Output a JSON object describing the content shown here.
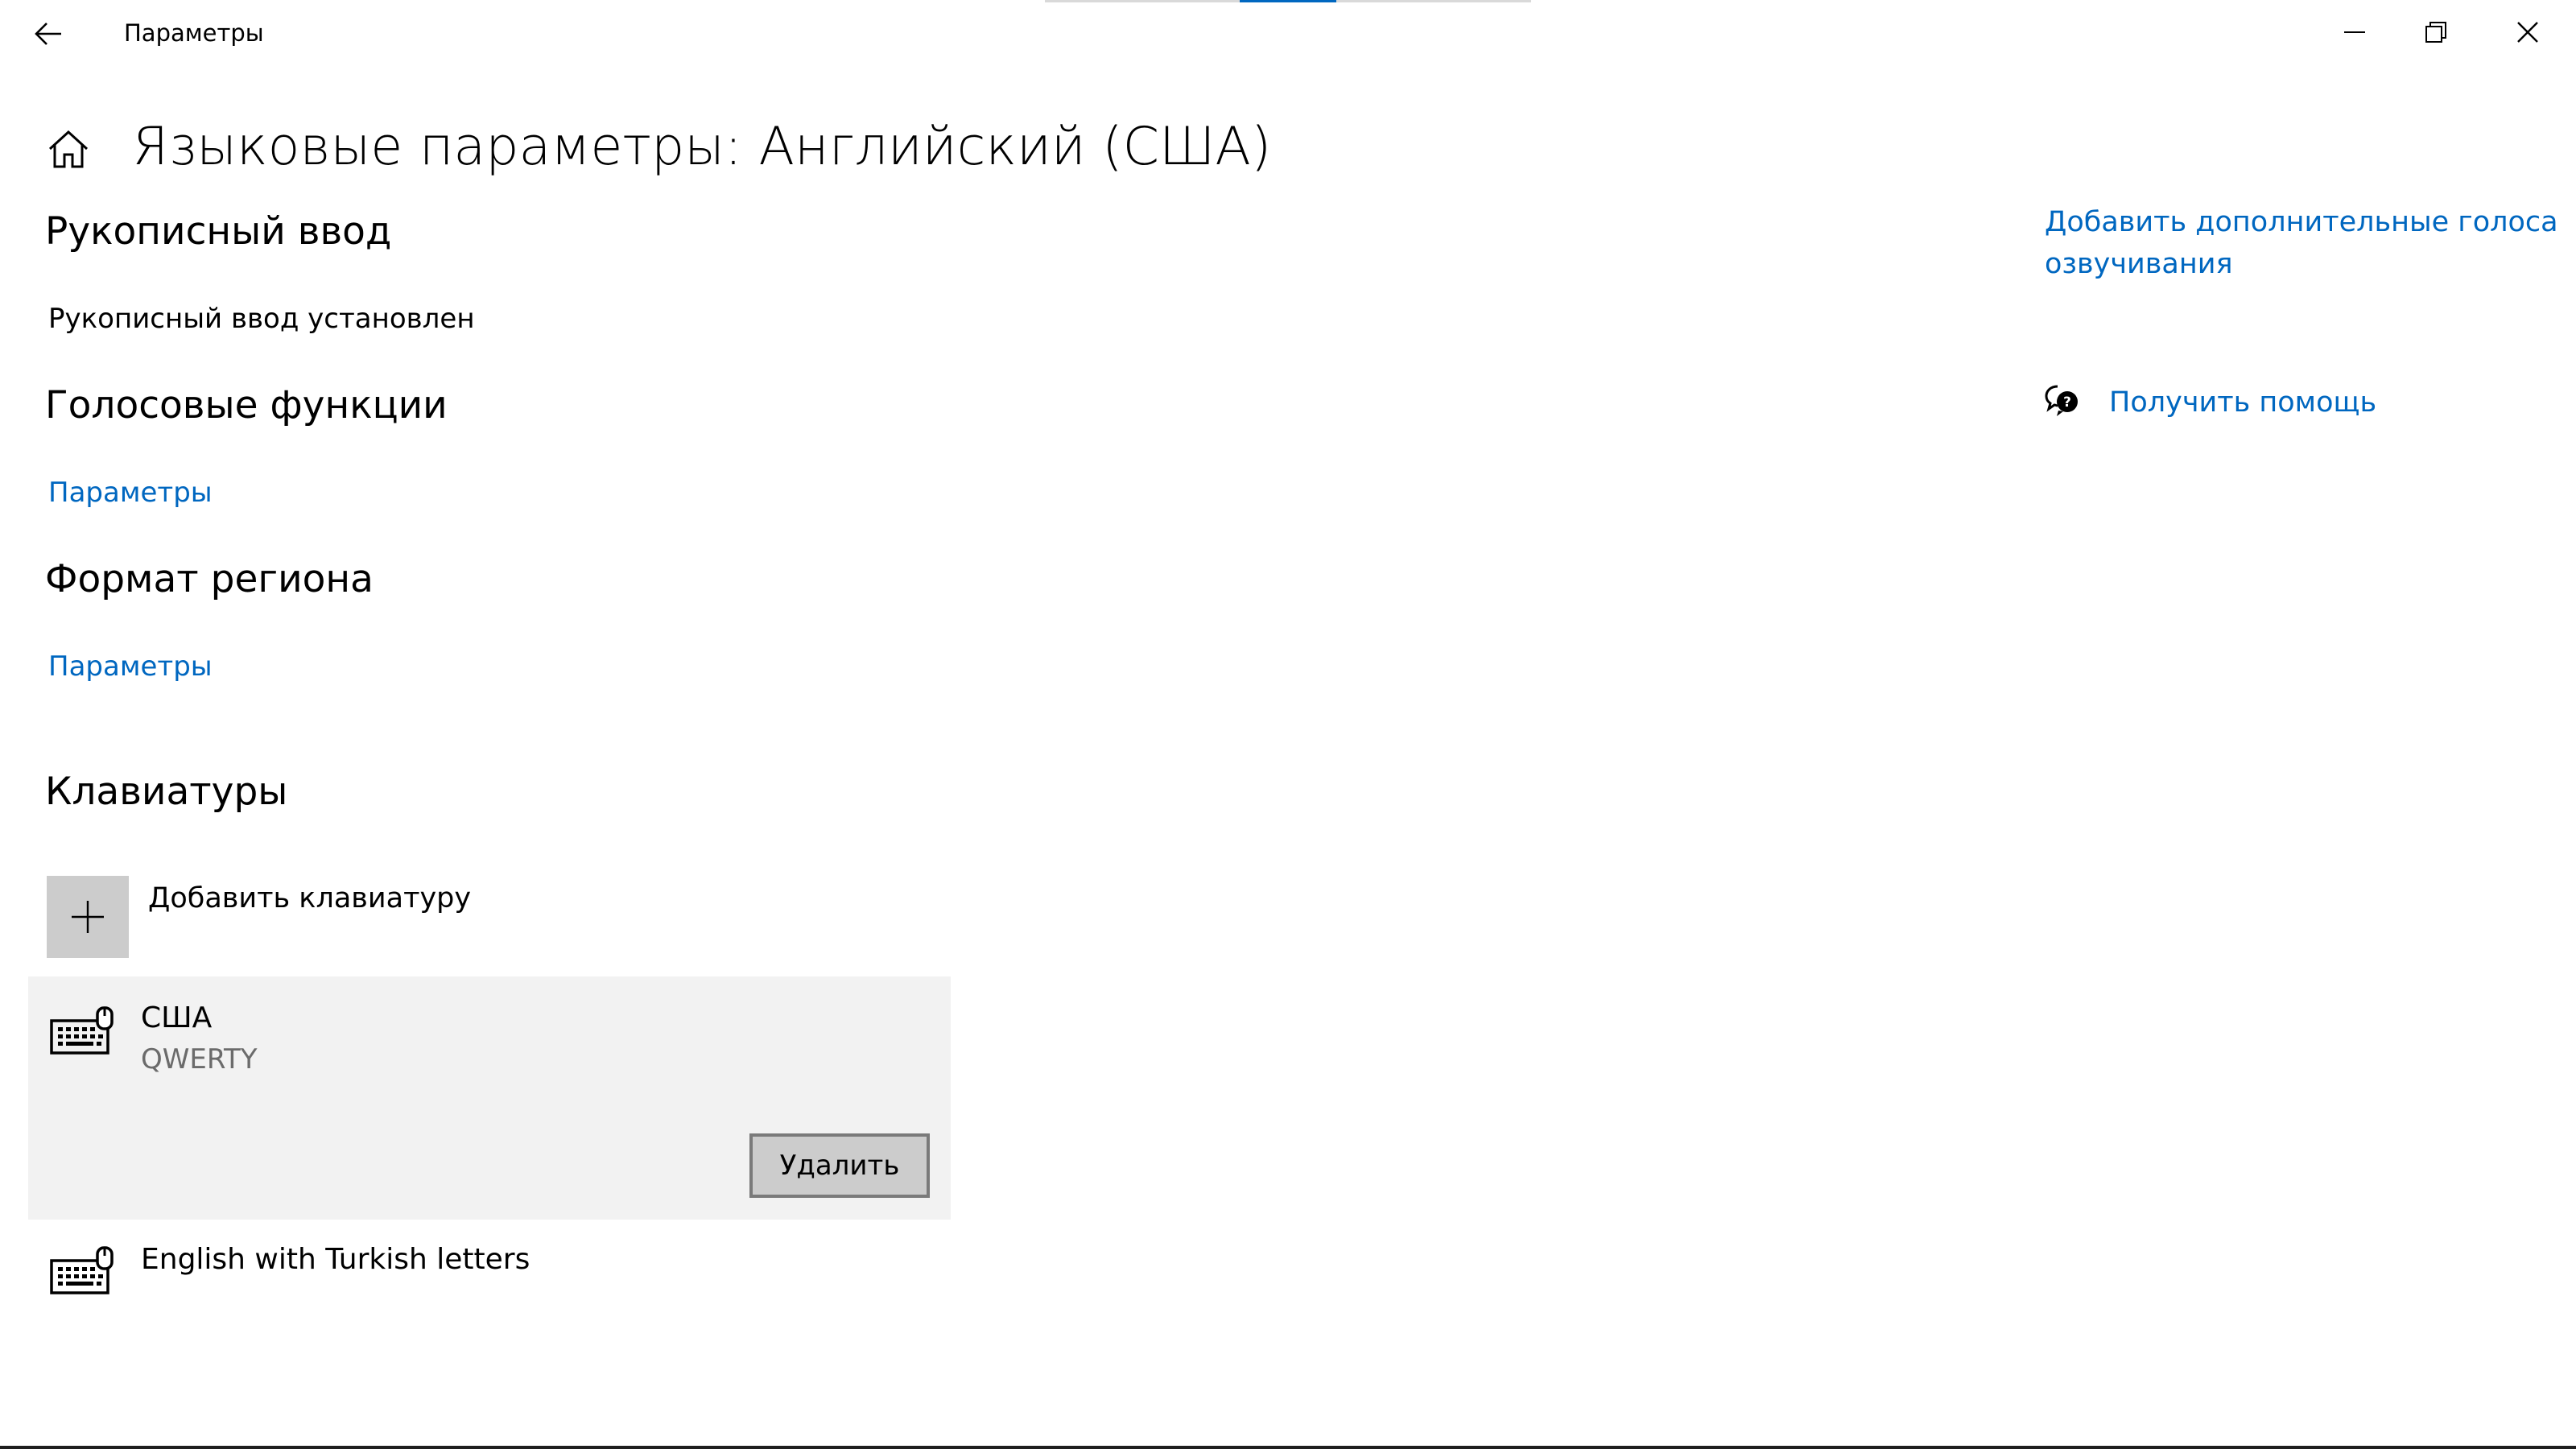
{
  "window": {
    "title": "Параметры",
    "controls": {
      "minimize_icon": "minimize-icon",
      "restore_icon": "restore-icon",
      "close_icon": "close-icon"
    }
  },
  "header": {
    "title": "Языковые параметры: Английский (США)"
  },
  "handwriting": {
    "title": "Рукописный ввод",
    "status": "Рукописный ввод установлен"
  },
  "speech": {
    "title": "Голосовые функции",
    "settings_link": "Параметры"
  },
  "region_format": {
    "title": "Формат региона",
    "settings_link": "Параметры"
  },
  "keyboards": {
    "title": "Клавиатуры",
    "add_label": "Добавить клавиатуру",
    "items": [
      {
        "name": "США",
        "layout": "QWERTY",
        "selected": true,
        "remove_label": "Удалить"
      },
      {
        "name": "English with Turkish letters",
        "layout": "",
        "selected": false
      }
    ]
  },
  "aside": {
    "add_voices_link": "Добавить дополнительные голоса озвучивания",
    "get_help_link": "Получить помощь"
  },
  "colors": {
    "accent": "#0067c0",
    "selected_bg": "#f2f2f2",
    "tile_bg": "#cccccc"
  }
}
